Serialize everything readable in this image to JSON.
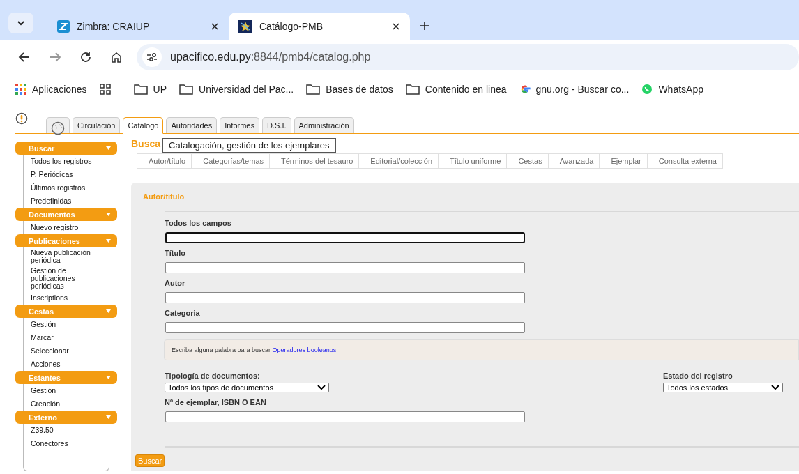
{
  "browser": {
    "tabs": [
      {
        "title": "Zimbra: CRAIUP",
        "selected": false
      },
      {
        "title": "Catálogo-PMB",
        "selected": true
      }
    ],
    "url_host": "upacifico.edu.py",
    "url_path": ":8844/pmb4/catalog.php",
    "bookmarks": [
      {
        "label": "Aplicaciones",
        "kind": "apps"
      },
      {
        "kind": "grid"
      },
      {
        "label": "UP",
        "kind": "folder"
      },
      {
        "label": "Universidad del Pac...",
        "kind": "folder"
      },
      {
        "label": "Bases de datos",
        "kind": "folder"
      },
      {
        "label": "Contenido en linea",
        "kind": "folder"
      },
      {
        "label": "gnu.org - Buscar co...",
        "kind": "google"
      },
      {
        "label": "WhatsApp",
        "kind": "whatsapp"
      }
    ]
  },
  "main_tabs": [
    {
      "label": "Circulación",
      "selected": false
    },
    {
      "label": "Catálogo",
      "selected": true
    },
    {
      "label": "Autoridades",
      "selected": false
    },
    {
      "label": "Informes",
      "selected": false
    },
    {
      "label": "D.S.I.",
      "selected": false
    },
    {
      "label": "Administración",
      "selected": false
    }
  ],
  "tooltip": "Catalogación, gestión de los ejemplares",
  "page_title": "Busca",
  "search_tabs": [
    "Autor/título",
    "Categorías/temas",
    "Términos del tesauro",
    "Editorial/colección",
    "Título uniforme",
    "Cestas",
    "Avanzada",
    "Ejemplar",
    "Consulta externa"
  ],
  "sidebar": [
    {
      "title": "Buscar",
      "items": [
        "Todos los registros",
        "P. Periódicas",
        "Últimos registros",
        "Predefinidas"
      ]
    },
    {
      "title": "Documentos",
      "items": [
        "Nuevo registro"
      ]
    },
    {
      "title": "Publicaciones",
      "items": [
        "Nueva publicación periódica",
        "Gestión de publicaciones periódicas",
        "Inscriptions"
      ]
    },
    {
      "title": "Cestas",
      "items": [
        "Gestión",
        "Marcar",
        "Seleccionar",
        "Acciones"
      ]
    },
    {
      "title": "Estantes",
      "items": [
        "Gestión",
        "Creación"
      ]
    },
    {
      "title": "Externo",
      "items": [
        "Z39.50",
        "Conectores"
      ]
    }
  ],
  "form": {
    "title": "Autor/título",
    "fields": [
      {
        "label": "Todos los campos",
        "focused": true
      },
      {
        "label": "Título",
        "focused": false
      },
      {
        "label": "Autor",
        "focused": false
      },
      {
        "label": "Categoria",
        "focused": false
      }
    ],
    "hint": "Escriba alguna palabra para buscar",
    "hint_link": "Operadores booleanos",
    "doc_type_label": "Tipología de documentos:",
    "doc_type_value": "Todos los tipos de documentos",
    "status_label": "Estado del registro",
    "status_value": "Todos los estados",
    "isbn_label": "Nº de ejemplar, ISBN O EAN",
    "submit": "Buscar"
  }
}
